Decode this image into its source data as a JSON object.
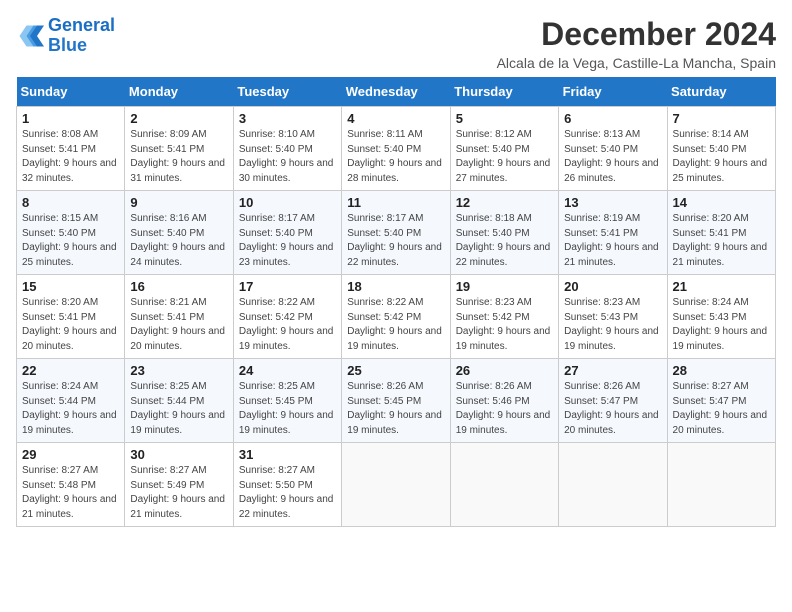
{
  "logo": {
    "line1": "General",
    "line2": "Blue"
  },
  "title": "December 2024",
  "subtitle": "Alcala de la Vega, Castille-La Mancha, Spain",
  "days_of_week": [
    "Sunday",
    "Monday",
    "Tuesday",
    "Wednesday",
    "Thursday",
    "Friday",
    "Saturday"
  ],
  "weeks": [
    [
      {
        "day": "1",
        "sunrise": "Sunrise: 8:08 AM",
        "sunset": "Sunset: 5:41 PM",
        "daylight": "Daylight: 9 hours and 32 minutes."
      },
      {
        "day": "2",
        "sunrise": "Sunrise: 8:09 AM",
        "sunset": "Sunset: 5:41 PM",
        "daylight": "Daylight: 9 hours and 31 minutes."
      },
      {
        "day": "3",
        "sunrise": "Sunrise: 8:10 AM",
        "sunset": "Sunset: 5:40 PM",
        "daylight": "Daylight: 9 hours and 30 minutes."
      },
      {
        "day": "4",
        "sunrise": "Sunrise: 8:11 AM",
        "sunset": "Sunset: 5:40 PM",
        "daylight": "Daylight: 9 hours and 28 minutes."
      },
      {
        "day": "5",
        "sunrise": "Sunrise: 8:12 AM",
        "sunset": "Sunset: 5:40 PM",
        "daylight": "Daylight: 9 hours and 27 minutes."
      },
      {
        "day": "6",
        "sunrise": "Sunrise: 8:13 AM",
        "sunset": "Sunset: 5:40 PM",
        "daylight": "Daylight: 9 hours and 26 minutes."
      },
      {
        "day": "7",
        "sunrise": "Sunrise: 8:14 AM",
        "sunset": "Sunset: 5:40 PM",
        "daylight": "Daylight: 9 hours and 25 minutes."
      }
    ],
    [
      {
        "day": "8",
        "sunrise": "Sunrise: 8:15 AM",
        "sunset": "Sunset: 5:40 PM",
        "daylight": "Daylight: 9 hours and 25 minutes."
      },
      {
        "day": "9",
        "sunrise": "Sunrise: 8:16 AM",
        "sunset": "Sunset: 5:40 PM",
        "daylight": "Daylight: 9 hours and 24 minutes."
      },
      {
        "day": "10",
        "sunrise": "Sunrise: 8:17 AM",
        "sunset": "Sunset: 5:40 PM",
        "daylight": "Daylight: 9 hours and 23 minutes."
      },
      {
        "day": "11",
        "sunrise": "Sunrise: 8:17 AM",
        "sunset": "Sunset: 5:40 PM",
        "daylight": "Daylight: 9 hours and 22 minutes."
      },
      {
        "day": "12",
        "sunrise": "Sunrise: 8:18 AM",
        "sunset": "Sunset: 5:40 PM",
        "daylight": "Daylight: 9 hours and 22 minutes."
      },
      {
        "day": "13",
        "sunrise": "Sunrise: 8:19 AM",
        "sunset": "Sunset: 5:41 PM",
        "daylight": "Daylight: 9 hours and 21 minutes."
      },
      {
        "day": "14",
        "sunrise": "Sunrise: 8:20 AM",
        "sunset": "Sunset: 5:41 PM",
        "daylight": "Daylight: 9 hours and 21 minutes."
      }
    ],
    [
      {
        "day": "15",
        "sunrise": "Sunrise: 8:20 AM",
        "sunset": "Sunset: 5:41 PM",
        "daylight": "Daylight: 9 hours and 20 minutes."
      },
      {
        "day": "16",
        "sunrise": "Sunrise: 8:21 AM",
        "sunset": "Sunset: 5:41 PM",
        "daylight": "Daylight: 9 hours and 20 minutes."
      },
      {
        "day": "17",
        "sunrise": "Sunrise: 8:22 AM",
        "sunset": "Sunset: 5:42 PM",
        "daylight": "Daylight: 9 hours and 19 minutes."
      },
      {
        "day": "18",
        "sunrise": "Sunrise: 8:22 AM",
        "sunset": "Sunset: 5:42 PM",
        "daylight": "Daylight: 9 hours and 19 minutes."
      },
      {
        "day": "19",
        "sunrise": "Sunrise: 8:23 AM",
        "sunset": "Sunset: 5:42 PM",
        "daylight": "Daylight: 9 hours and 19 minutes."
      },
      {
        "day": "20",
        "sunrise": "Sunrise: 8:23 AM",
        "sunset": "Sunset: 5:43 PM",
        "daylight": "Daylight: 9 hours and 19 minutes."
      },
      {
        "day": "21",
        "sunrise": "Sunrise: 8:24 AM",
        "sunset": "Sunset: 5:43 PM",
        "daylight": "Daylight: 9 hours and 19 minutes."
      }
    ],
    [
      {
        "day": "22",
        "sunrise": "Sunrise: 8:24 AM",
        "sunset": "Sunset: 5:44 PM",
        "daylight": "Daylight: 9 hours and 19 minutes."
      },
      {
        "day": "23",
        "sunrise": "Sunrise: 8:25 AM",
        "sunset": "Sunset: 5:44 PM",
        "daylight": "Daylight: 9 hours and 19 minutes."
      },
      {
        "day": "24",
        "sunrise": "Sunrise: 8:25 AM",
        "sunset": "Sunset: 5:45 PM",
        "daylight": "Daylight: 9 hours and 19 minutes."
      },
      {
        "day": "25",
        "sunrise": "Sunrise: 8:26 AM",
        "sunset": "Sunset: 5:45 PM",
        "daylight": "Daylight: 9 hours and 19 minutes."
      },
      {
        "day": "26",
        "sunrise": "Sunrise: 8:26 AM",
        "sunset": "Sunset: 5:46 PM",
        "daylight": "Daylight: 9 hours and 19 minutes."
      },
      {
        "day": "27",
        "sunrise": "Sunrise: 8:26 AM",
        "sunset": "Sunset: 5:47 PM",
        "daylight": "Daylight: 9 hours and 20 minutes."
      },
      {
        "day": "28",
        "sunrise": "Sunrise: 8:27 AM",
        "sunset": "Sunset: 5:47 PM",
        "daylight": "Daylight: 9 hours and 20 minutes."
      }
    ],
    [
      {
        "day": "29",
        "sunrise": "Sunrise: 8:27 AM",
        "sunset": "Sunset: 5:48 PM",
        "daylight": "Daylight: 9 hours and 21 minutes."
      },
      {
        "day": "30",
        "sunrise": "Sunrise: 8:27 AM",
        "sunset": "Sunset: 5:49 PM",
        "daylight": "Daylight: 9 hours and 21 minutes."
      },
      {
        "day": "31",
        "sunrise": "Sunrise: 8:27 AM",
        "sunset": "Sunset: 5:50 PM",
        "daylight": "Daylight: 9 hours and 22 minutes."
      },
      null,
      null,
      null,
      null
    ]
  ]
}
